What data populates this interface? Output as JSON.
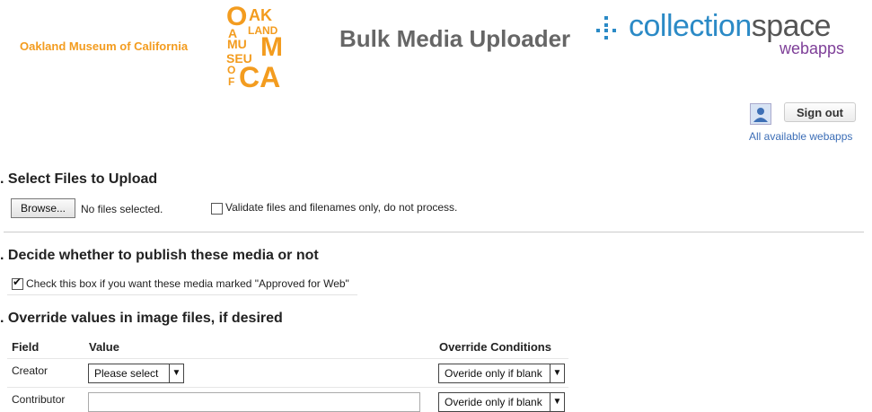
{
  "header": {
    "museum_name": "Oakland Museum of California",
    "logo_letters": {
      "r1a": "O",
      "r1b": "AK",
      "r2a": "A",
      "r2b": "LAND",
      "r3a": "MU",
      "r3b": "M",
      "r4a": "SEU",
      "r4b": "M",
      "r5a": "O",
      "r5b": "F",
      "r6a": "CA"
    },
    "app_title": "Bulk Media Uploader",
    "cs_logo_main": "collection",
    "cs_logo_space": "space",
    "cs_logo_sub": "webapps"
  },
  "account": {
    "signout_label": "Sign out",
    "webapps_link": "All available webapps"
  },
  "section1": {
    "title": ". Select Files to Upload",
    "browse_label": "Browse...",
    "file_status": "No files selected.",
    "validate_checked": false,
    "validate_label": "Validate files and filenames only, do not process."
  },
  "section2": {
    "title": ". Decide whether to publish these media or not",
    "approved_checked": true,
    "approved_label": "Check this box if you want these media marked \"Approved for Web\""
  },
  "section3": {
    "title": ". Override values in image files, if desired",
    "columns": [
      "Field",
      "Value",
      "Override Conditions"
    ],
    "rows": [
      {
        "field": "Creator",
        "value": "Please select",
        "condition": "Overide only if blank"
      },
      {
        "field": "Contributor",
        "value": "",
        "condition": "Overide only if blank"
      }
    ]
  },
  "colors": {
    "orange": "#f39c1f",
    "cs_blue": "#2b8ac6",
    "cs_purple": "#7e3f98",
    "link": "#3b6db6"
  }
}
